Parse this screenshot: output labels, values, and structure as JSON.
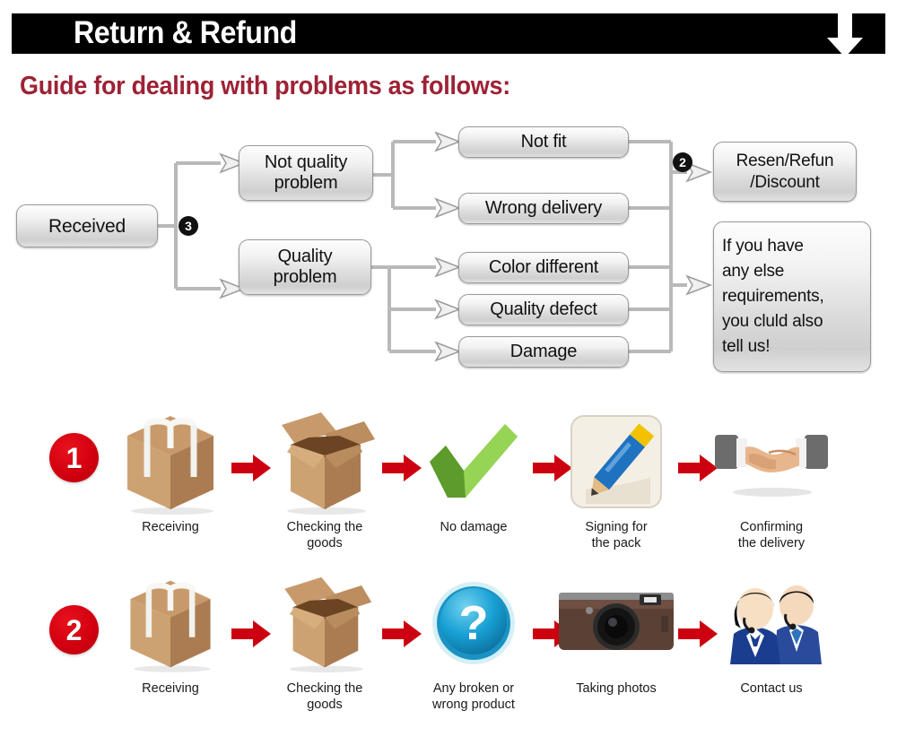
{
  "header": {
    "title": "Return & Refund",
    "arrow_icon": "down-arrow-icon",
    "bar_color": "#000000",
    "title_color": "#ffffff"
  },
  "subtitle": {
    "text": "Guide for dealing with problems as follows:",
    "color": "#9d2235"
  },
  "flowchart": {
    "start": {
      "label": "Received"
    },
    "badge_three": "3",
    "badge_two": "2",
    "branches": [
      {
        "label": "Not quality\nproblem",
        "line1": "Not quality",
        "line2": "problem"
      },
      {
        "label": "Quality\nproblem",
        "line1": "Quality",
        "line2": "problem"
      }
    ],
    "not_quality_reasons": [
      {
        "label": "Not fit"
      },
      {
        "label": "Wrong delivery"
      }
    ],
    "quality_reasons": [
      {
        "label": "Color different"
      },
      {
        "label": "Quality defect"
      },
      {
        "label": "Damage"
      }
    ],
    "outcomes": [
      {
        "line1": "Resen/Refun",
        "line2": "/Discount"
      },
      {
        "line1": "If you have",
        "line2": "any else",
        "line3": "requirements,",
        "line4": "you cluld also",
        "line5": "tell us!"
      }
    ]
  },
  "process_rows": [
    {
      "number": "1",
      "steps": [
        {
          "icon": "sealed-box-icon",
          "caption_line1": "Receiving",
          "caption_line2": ""
        },
        {
          "icon": "open-box-icon",
          "caption_line1": "Checking the",
          "caption_line2": "goods"
        },
        {
          "icon": "green-check-icon",
          "caption_line1": "No damage",
          "caption_line2": ""
        },
        {
          "icon": "pencil-signing-icon",
          "caption_line1": "Signing for",
          "caption_line2": "the pack"
        },
        {
          "icon": "handshake-icon",
          "caption_line1": "Confirming",
          "caption_line2": "the delivery"
        }
      ]
    },
    {
      "number": "2",
      "steps": [
        {
          "icon": "sealed-box-icon",
          "caption_line1": "Receiving",
          "caption_line2": ""
        },
        {
          "icon": "open-box-icon",
          "caption_line1": "Checking the",
          "caption_line2": "goods"
        },
        {
          "icon": "blue-question-icon",
          "caption_line1": "Any broken or",
          "caption_line2": "wrong product"
        },
        {
          "icon": "camera-icon",
          "caption_line1": "Taking photos",
          "caption_line2": ""
        },
        {
          "icon": "support-agents-icon",
          "caption_line1": "Contact us",
          "caption_line2": ""
        }
      ]
    }
  ],
  "colors": {
    "red_arrow": "#cc0010",
    "red_circle": "#d20010",
    "box_border": "#9a9a9a",
    "connector": "#b4b4b4"
  }
}
